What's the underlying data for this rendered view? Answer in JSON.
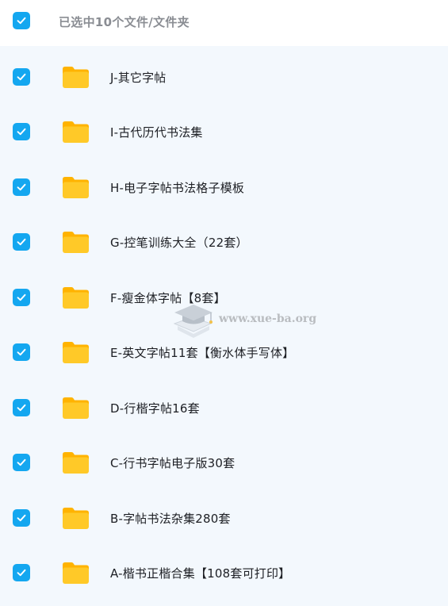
{
  "header": {
    "selection_text": "已选中10个文件/文件夹"
  },
  "items": [
    {
      "name": "J-其它字帖"
    },
    {
      "name": "I-古代历代书法集"
    },
    {
      "name": "H-电子字帖书法格子模板"
    },
    {
      "name": "G-控笔训练大全（22套）"
    },
    {
      "name": "F-瘦金体字帖【8套】"
    },
    {
      "name": "E-英文字帖11套【衡水体手写体】"
    },
    {
      "name": "D-行楷字帖16套"
    },
    {
      "name": "C-行书字帖电子版30套"
    },
    {
      "name": "B-字帖书法杂集280套"
    },
    {
      "name": "A-楷书正楷合集【108套可打印】"
    }
  ],
  "watermark": {
    "text": "www.xue-ba.org"
  },
  "colors": {
    "checkbox": "#14a7f0",
    "folder": "#ffc51a",
    "list_background": "#f3f8fd"
  },
  "icons": {
    "checkbox": "checkmark-icon",
    "folder": "folder-icon"
  }
}
